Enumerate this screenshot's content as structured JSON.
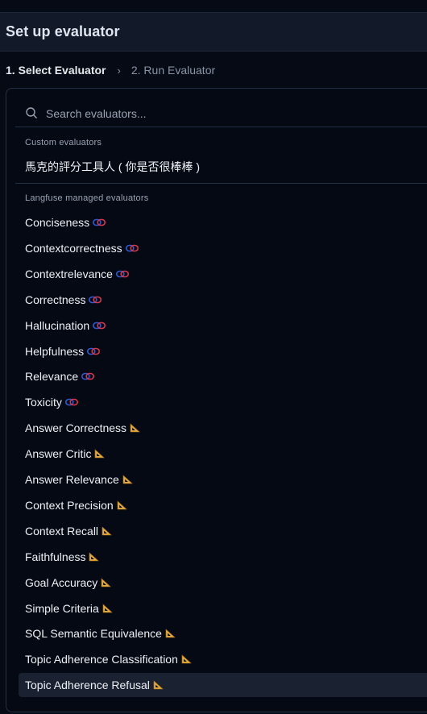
{
  "header": {
    "title": "Set up evaluator"
  },
  "steps": {
    "step1": "1. Select Evaluator",
    "separator": "›",
    "step2": "2. Run Evaluator"
  },
  "search": {
    "placeholder": "Search evaluators...",
    "value": ""
  },
  "custom_group": {
    "label": "Custom evaluators",
    "items": [
      {
        "label": "馬克的評分工具人 ( 你是否很棒棒 )"
      }
    ]
  },
  "managed_group": {
    "label": "Langfuse managed evaluators",
    "items": [
      {
        "label": "Conciseness",
        "icon": "chain-link-icon"
      },
      {
        "label": "Contextcorrectness",
        "icon": "chain-link-icon"
      },
      {
        "label": "Contextrelevance",
        "icon": "chain-link-icon"
      },
      {
        "label": "Correctness",
        "icon": "chain-link-icon"
      },
      {
        "label": "Hallucination",
        "icon": "chain-link-icon"
      },
      {
        "label": "Helpfulness",
        "icon": "chain-link-icon"
      },
      {
        "label": "Relevance",
        "icon": "chain-link-icon"
      },
      {
        "label": "Toxicity",
        "icon": "chain-link-icon"
      },
      {
        "label": "Answer Correctness",
        "icon": "triangular-ruler-icon"
      },
      {
        "label": "Answer Critic",
        "icon": "triangular-ruler-icon"
      },
      {
        "label": "Answer Relevance",
        "icon": "triangular-ruler-icon"
      },
      {
        "label": "Context Precision",
        "icon": "triangular-ruler-icon"
      },
      {
        "label": "Context Recall",
        "icon": "triangular-ruler-icon"
      },
      {
        "label": "Faithfulness",
        "icon": "triangular-ruler-icon"
      },
      {
        "label": "Goal Accuracy",
        "icon": "triangular-ruler-icon"
      },
      {
        "label": "Simple Criteria",
        "icon": "triangular-ruler-icon"
      },
      {
        "label": "SQL Semantic Equivalence",
        "icon": "triangular-ruler-icon"
      },
      {
        "label": "Topic Adherence Classification",
        "icon": "triangular-ruler-icon"
      },
      {
        "label": "Topic Adherence Refusal",
        "icon": "triangular-ruler-icon",
        "selected": true
      }
    ]
  },
  "colors": {
    "background": "#060a14",
    "header_bg": "#121a2a",
    "border": "#243046",
    "selected_row": "#1a2232",
    "muted_text": "#9aa3b3"
  }
}
